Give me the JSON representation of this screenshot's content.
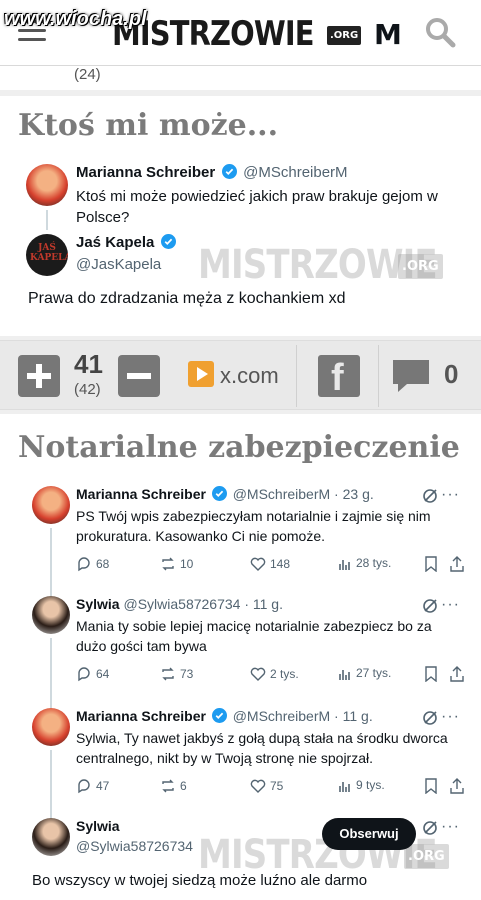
{
  "header": {
    "site_watermark": "www.wiocha.pl",
    "logo_text": "MISTRZOWIE",
    "logo_org": ".ORG",
    "logo_cut": "M"
  },
  "prev_post": {
    "score_sub": "(24)"
  },
  "post1": {
    "title": "Ktoś mi może...",
    "tweet": {
      "author_name": "Marianna Schreiber",
      "author_handle": "@MSchreiberM",
      "text": "Ktoś mi może powiedzieć jakich praw brakuje gejom w Polsce?"
    },
    "reply": {
      "author_name": "Jaś Kapela",
      "author_handle": "@JasKapela",
      "avatar_text": "JAŚ KAPELA",
      "text": "Prawa do zdradzania męża z kochankiem xd"
    },
    "watermark": "MISTRZOWIE",
    "watermark_org": ".ORG",
    "bar": {
      "score": "41",
      "score_sub": "(42)",
      "source": "x.com",
      "comments": "0"
    }
  },
  "post2": {
    "title": "Notarialne zabezpieczenie",
    "replies": [
      {
        "author_name": "Marianna Schreiber",
        "author_handle": "@MSchreiberM · 23 g.",
        "text": "PS Twój wpis zabezpieczyłam notarialnie i zajmie się nim prokuratura. Kasowanko Ci nie pomoże.",
        "replies": "68",
        "reposts": "10",
        "likes": "148",
        "views": "28 tys."
      },
      {
        "author_name": "Sylwia",
        "author_handle": "@Sylwia58726734 · 11 g.",
        "text": "Mania ty sobie lepiej macicę notarialnie zabezpiecz bo za dużo gości tam bywa",
        "replies": "64",
        "reposts": "73",
        "likes": "2 tys.",
        "views": "27 tys."
      },
      {
        "author_name": "Marianna Schreiber",
        "author_handle": "@MSchreiberM · 11 g.",
        "text": "Sylwia, Ty nawet jakbyś z gołą dupą stała na środku dworca centralnego, nikt by w Twoją stronę nie spojrzał.",
        "replies": "47",
        "reposts": "6",
        "likes": "75",
        "views": "9 tys."
      }
    ],
    "final": {
      "author_name": "Sylwia",
      "author_handle": "@Sylwia58726734",
      "follow_label": "Obserwuj",
      "text": "Bo wszyscy w twojej siedzą może luźno ale darmo"
    },
    "more_glyph": "···",
    "watermark": "MISTRZOWIE",
    "watermark_org": ".ORG"
  },
  "colors": {
    "accent_verified": "#1d9bf0",
    "vote_grey": "#777777",
    "source_orange": "#f0a030"
  },
  "icons": [
    "menu-icon",
    "search-icon",
    "verified-icon",
    "plus-icon",
    "minus-icon",
    "play-icon",
    "facebook-icon",
    "comment-icon",
    "reply-icon",
    "repost-icon",
    "like-icon",
    "views-icon",
    "bookmark-icon",
    "share-icon",
    "grok-icon",
    "more-icon"
  ]
}
